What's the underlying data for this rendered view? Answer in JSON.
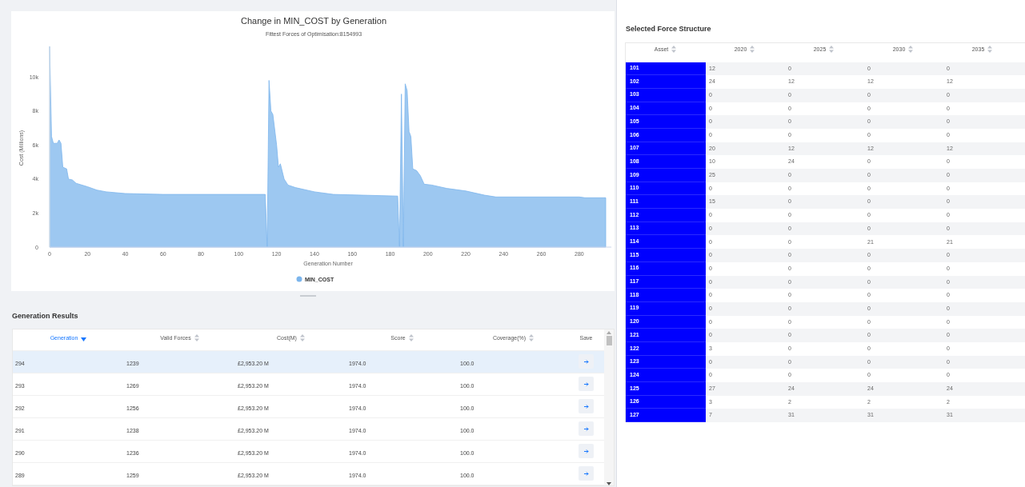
{
  "chart_panel": {
    "subtitle": "Fittest Forces of Optimisation:8154993",
    "chart_data": {
      "type": "area",
      "title": "Change in MIN_COST by Generation",
      "xlabel": "Generation Number",
      "ylabel": "Cost (Millions)",
      "x": [
        0,
        1,
        2,
        4,
        5,
        6,
        7,
        9,
        10,
        12,
        14,
        20,
        25,
        30,
        40,
        60,
        114,
        115,
        116,
        117,
        118,
        120,
        121,
        122,
        124,
        126,
        130,
        140,
        150,
        184,
        185,
        186,
        187,
        188,
        189,
        190,
        191,
        192,
        194,
        196,
        198,
        202,
        210,
        220,
        230,
        236,
        280,
        283,
        294
      ],
      "series": [
        {
          "name": "MIN_COST",
          "color": "#7cb5ec",
          "values": [
            11800,
            6500,
            6100,
            6100,
            6300,
            6100,
            4700,
            4600,
            4000,
            3950,
            3750,
            3550,
            3350,
            3250,
            3150,
            3100,
            3100,
            0,
            9800,
            8000,
            7800,
            6000,
            4700,
            4900,
            4000,
            3650,
            3500,
            3250,
            3100,
            3000,
            0,
            9000,
            0,
            9600,
            9200,
            6800,
            6500,
            4600,
            4500,
            4200,
            3700,
            3650,
            3450,
            3300,
            3050,
            2950,
            2950,
            2900,
            2900
          ]
        }
      ],
      "xlim": [
        0,
        297
      ],
      "ylim": [
        0,
        11800
      ],
      "xticks": [
        0,
        20,
        40,
        60,
        80,
        100,
        120,
        140,
        160,
        180,
        200,
        220,
        240,
        260,
        280
      ],
      "yticks": [
        {
          "value": 0,
          "label": "0"
        },
        {
          "value": 2000,
          "label": "2k"
        },
        {
          "value": 4000,
          "label": "4k"
        },
        {
          "value": 6000,
          "label": "6k"
        },
        {
          "value": 8000,
          "label": "8k"
        },
        {
          "value": 10000,
          "label": "10k"
        }
      ]
    }
  },
  "generation_results": {
    "title": "Generation Results",
    "columns": [
      {
        "label": "Generation",
        "sorted": true
      },
      {
        "label": "Valid Forces",
        "sorted": false
      },
      {
        "label": "Cost(M)",
        "sorted": false
      },
      {
        "label": "Score",
        "sorted": false
      },
      {
        "label": "Coverage(%)",
        "sorted": false
      },
      {
        "label": "Save",
        "sorted": false
      }
    ],
    "rows": [
      {
        "cells": [
          "294",
          "1239",
          "£2,953.20 M",
          "1974.0",
          "100.0"
        ],
        "selected": true
      },
      {
        "cells": [
          "293",
          "1269",
          "£2,953.20 M",
          "1974.0",
          "100.0"
        ],
        "selected": false
      },
      {
        "cells": [
          "292",
          "1256",
          "£2,953.20 M",
          "1974.0",
          "100.0"
        ],
        "selected": false
      },
      {
        "cells": [
          "291",
          "1238",
          "£2,953.20 M",
          "1974.0",
          "100.0"
        ],
        "selected": false
      },
      {
        "cells": [
          "290",
          "1236",
          "£2,953.20 M",
          "1974.0",
          "100.0"
        ],
        "selected": false
      },
      {
        "cells": [
          "289",
          "1259",
          "£2,953.20 M",
          "1974.0",
          "100.0"
        ],
        "selected": false
      }
    ]
  },
  "force_structure": {
    "title": "Selected Force Structure",
    "columns": [
      "Asset",
      "2020",
      "2025",
      "2030",
      "2035"
    ],
    "rows": [
      [
        "101",
        "12",
        "0",
        "0",
        "0"
      ],
      [
        "102",
        "24",
        "12",
        "12",
        "12"
      ],
      [
        "103",
        "0",
        "0",
        "0",
        "0"
      ],
      [
        "104",
        "0",
        "0",
        "0",
        "0"
      ],
      [
        "105",
        "0",
        "0",
        "0",
        "0"
      ],
      [
        "106",
        "0",
        "0",
        "0",
        "0"
      ],
      [
        "107",
        "20",
        "12",
        "12",
        "12"
      ],
      [
        "108",
        "10",
        "24",
        "0",
        "0"
      ],
      [
        "109",
        "25",
        "0",
        "0",
        "0"
      ],
      [
        "110",
        "0",
        "0",
        "0",
        "0"
      ],
      [
        "111",
        "15",
        "0",
        "0",
        "0"
      ],
      [
        "112",
        "0",
        "0",
        "0",
        "0"
      ],
      [
        "113",
        "0",
        "0",
        "0",
        "0"
      ],
      [
        "114",
        "0",
        "0",
        "21",
        "21"
      ],
      [
        "115",
        "0",
        "0",
        "0",
        "0"
      ],
      [
        "116",
        "0",
        "0",
        "0",
        "0"
      ],
      [
        "117",
        "0",
        "0",
        "0",
        "0"
      ],
      [
        "118",
        "0",
        "0",
        "0",
        "0"
      ],
      [
        "119",
        "0",
        "0",
        "0",
        "0"
      ],
      [
        "120",
        "0",
        "0",
        "0",
        "0"
      ],
      [
        "121",
        "0",
        "0",
        "0",
        "0"
      ],
      [
        "122",
        "3",
        "0",
        "0",
        "0"
      ],
      [
        "123",
        "0",
        "0",
        "0",
        "0"
      ],
      [
        "124",
        "0",
        "0",
        "0",
        "0"
      ],
      [
        "125",
        "27",
        "24",
        "24",
        "24"
      ],
      [
        "126",
        "3",
        "2",
        "2",
        "2"
      ],
      [
        "127",
        "7",
        "31",
        "31",
        "31"
      ]
    ]
  }
}
